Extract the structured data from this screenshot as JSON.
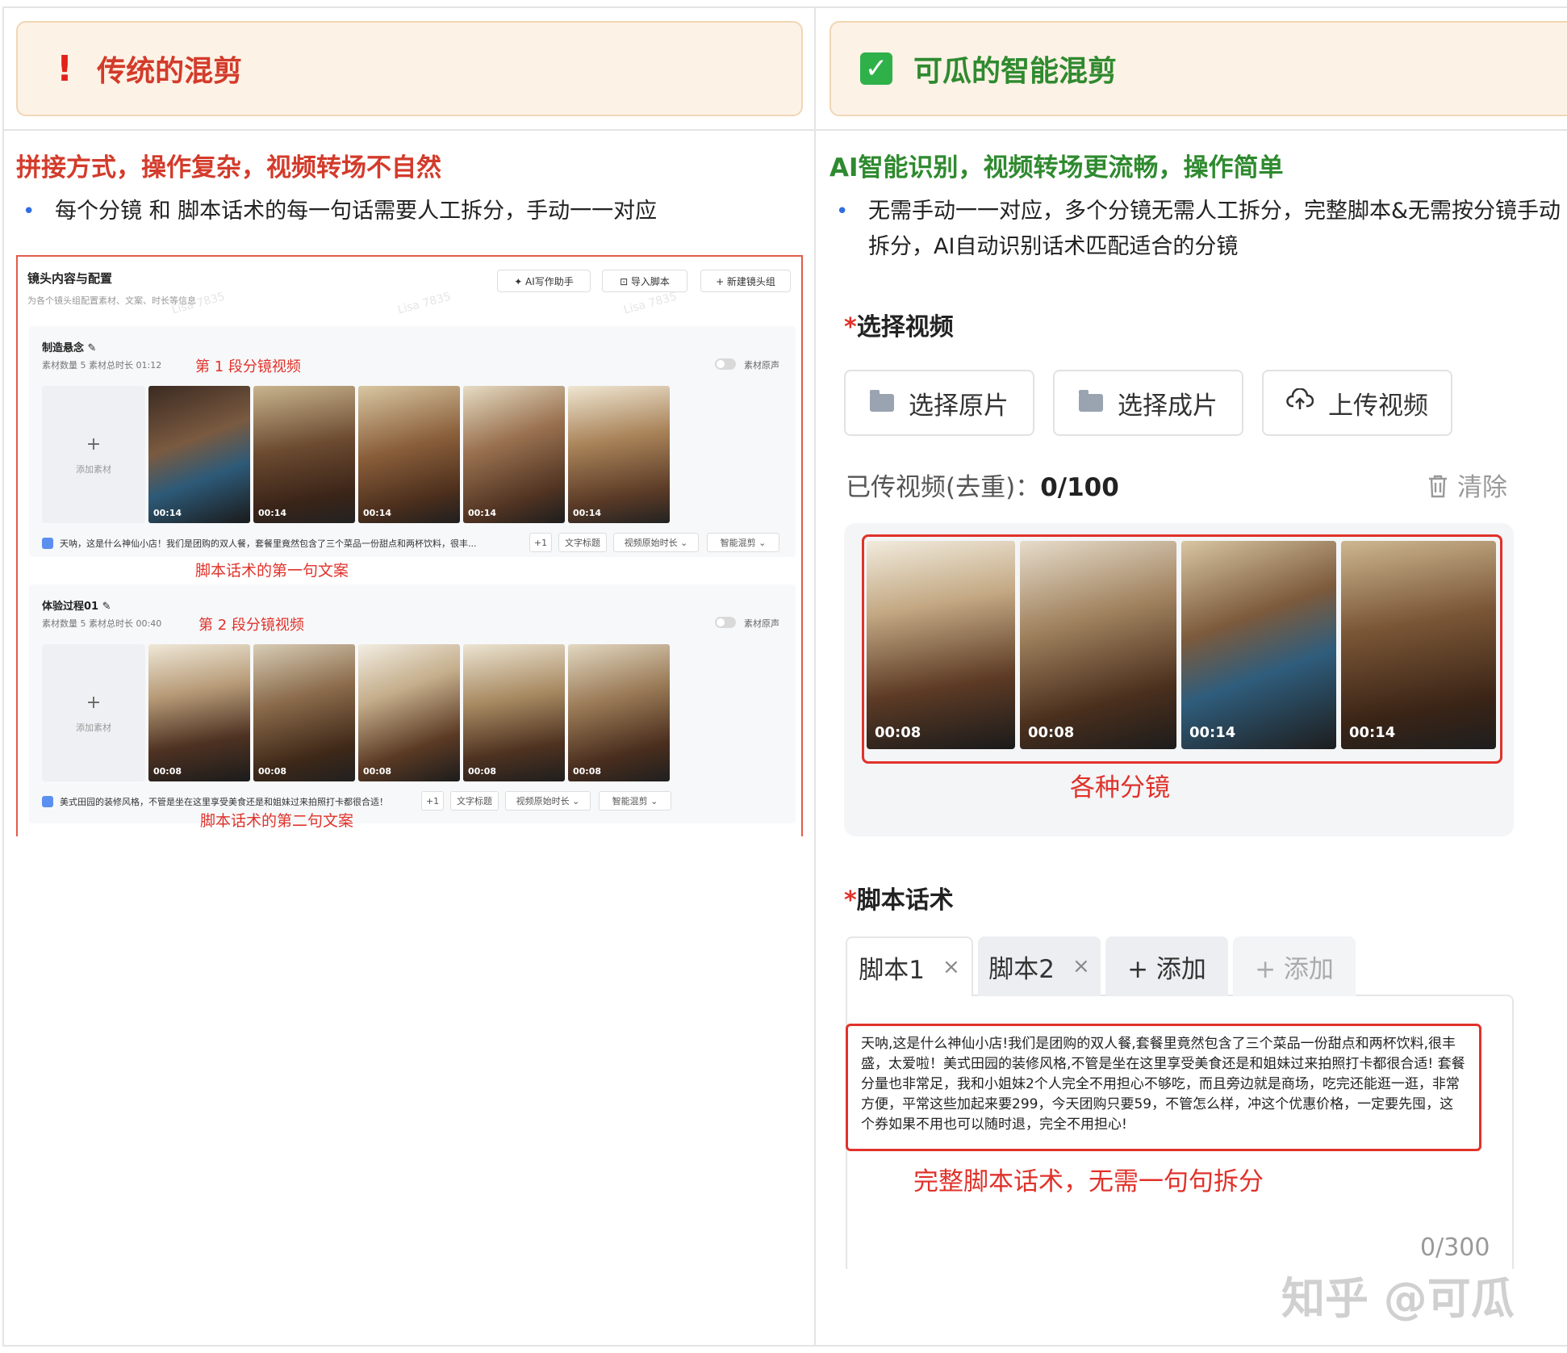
{
  "left": {
    "banner_icon": "!",
    "banner_title": "传统的混剪",
    "heading": "拼接方式，操作复杂，视频转场不自然",
    "bullet": "每个分镜 和 脚本话术的每一句话需要人工拆分，手动一一对应",
    "screenshot": {
      "title": "镜头内容与配置",
      "subtitle": "为各个镜头组配置素材、文案、时长等信息",
      "buttons": [
        "✦ AI写作助手",
        "⊡ 导入脚本",
        "+ 新建镜头组"
      ],
      "watermark": "Lisa 7835",
      "groups": [
        {
          "name": "制造悬念 ✎",
          "meta": "素材数量  5  素材总时长  01:12",
          "annotation": "第 1 段分镜视频",
          "toggle_label": "素材原声",
          "add_plus": "+",
          "add_label": "添加素材",
          "thumb_times": [
            "00:14",
            "00:14",
            "00:14",
            "00:14",
            "00:14"
          ],
          "script_text": "天呐，这是什么神仙小店！我们是团购的双人餐，套餐里竟然包含了三个菜品一份甜点和两杯饮料，很丰...",
          "plus_count": "+1",
          "text_title_btn": "文字标题",
          "duration_btn": "视频原始时长 ⌄",
          "smart_btn": "智能混剪 ⌄",
          "caption": "脚本话术的第一句文案"
        },
        {
          "name": "体验过程01 ✎",
          "meta": "素材数量  5  素材总时长  00:40",
          "annotation": "第 2 段分镜视频",
          "toggle_label": "素材原声",
          "add_plus": "+",
          "add_label": "添加素材",
          "thumb_times": [
            "00:08",
            "00:08",
            "00:08",
            "00:08",
            "00:08"
          ],
          "script_text": "美式田园的装修风格，不管是坐在这里享受美食还是和姐妹过来拍照打卡都很合适！",
          "plus_count": "+1",
          "text_title_btn": "文字标题",
          "duration_btn": "视频原始时长 ⌄",
          "smart_btn": "智能混剪 ⌄",
          "caption": "脚本话术的第二句文案"
        }
      ]
    }
  },
  "right": {
    "banner_icon": "✓",
    "banner_title": "可瓜的智能混剪",
    "heading": "AI智能识别，视频转场更流畅，操作简单",
    "bullet": "无需手动一一对应，多个分镜无需人工拆分，完整脚本&无需按分镜手动拆分，AI自动识别话术匹配适合的分镜",
    "select_video_label": "选择视频",
    "video_buttons": [
      "选择原片",
      "选择成片",
      "上传视频"
    ],
    "uploaded_label": "已传视频(去重)：",
    "uploaded_count": "0/100",
    "clear_label": "清除",
    "video_times": [
      "00:08",
      "00:08",
      "00:14",
      "00:14"
    ],
    "shots_caption": "各种分镜",
    "script_label": "脚本话术",
    "tabs": [
      {
        "label": "脚本1",
        "close": "×"
      },
      {
        "label": "脚本2",
        "close": "×"
      },
      {
        "label": "+ 添加"
      },
      {
        "label": "+ 添加"
      }
    ],
    "script_text": "天呐,这是什么神仙小店!我们是团购的双人餐,套餐里竟然包含了三个菜品一份甜点和两杯饮料,很丰盛，太爱啦！美式田园的装修风格,不管是坐在这里享受美食还是和姐妹过来拍照打卡都很合适! 套餐分量也非常足，我和小姐妹2个人完全不用担心不够吃，而且旁边就是商场，吃完还能逛一逛，非常方便，平常这些加起来要299，今天团购只要59，不管怎么样，冲这个优惠价格，一定要先囤，这个券如果不用也可以随时退，完全不用担心!",
    "script_caption": "完整脚本话术，无需一句句拆分",
    "char_counter": "0/300"
  },
  "watermark_site": "知乎 @可瓜",
  "colors": {
    "red": "#e0322a",
    "green": "#2f8a2f",
    "banner_bg": "#fdf2e6",
    "bullet_dot": "#2f6ee0"
  }
}
